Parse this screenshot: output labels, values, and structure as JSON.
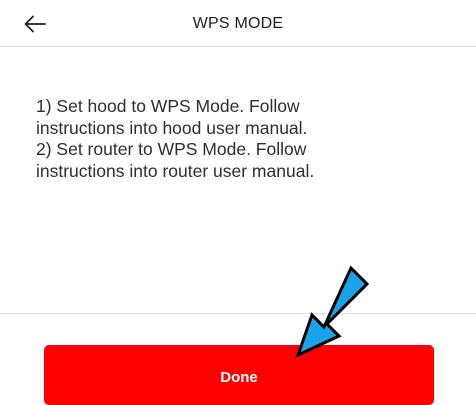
{
  "header": {
    "back_icon": "arrow-left-icon",
    "title": "WPS MODE"
  },
  "instructions": {
    "lines": [
      "1) Set hood to WPS Mode. Follow",
      "instructions into hood user manual.",
      "2) Set router to WPS Mode. Follow",
      "instructions into router user manual."
    ]
  },
  "footer": {
    "done_label": "Done"
  },
  "colors": {
    "primary_button": "#ff0000",
    "annotation_arrow": "#1aa3e8"
  },
  "annotation": {
    "icon": "blue-arrow-pointer-icon"
  }
}
